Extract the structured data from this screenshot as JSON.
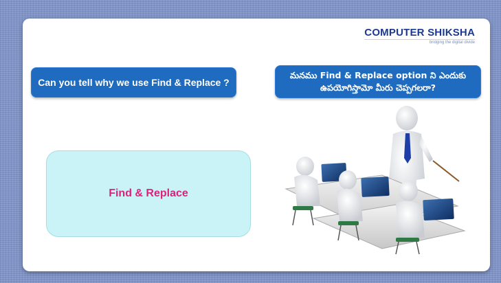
{
  "logo": {
    "word1": "COMPUTER",
    "word2": " SHIKSHA",
    "tagline": "bridging the digital divide"
  },
  "question_en": "Can you tell why we use Find & Replace ?",
  "question_te": {
    "line1": "మనము Find & Replace option ని ఎందుకు",
    "line2": "ఉపయోగిస్తామో మీరు చెప్పగలరా?"
  },
  "answer_label": "Find & Replace",
  "colors": {
    "background": "#7f93c4",
    "question_box": "#1e6bbf",
    "answer_box": "#c9f3f6",
    "answer_text": "#e0207a"
  }
}
